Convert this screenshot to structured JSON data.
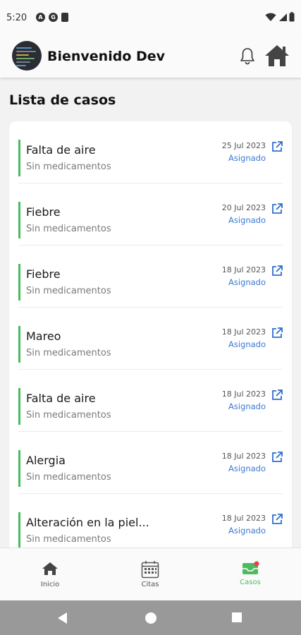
{
  "status_bar": {
    "time": "5:20",
    "left_icons": [
      "A",
      "G",
      "sd-card-icon"
    ]
  },
  "header": {
    "greeting": "Bienvenido Dev"
  },
  "page": {
    "title": "Lista de casos"
  },
  "cases": [
    {
      "title": "Falta de aire",
      "subtitle": "Sin medicamentos",
      "date": "25 Jul 2023",
      "status": "Asignado"
    },
    {
      "title": "Fiebre",
      "subtitle": "Sin medicamentos",
      "date": "20 Jul 2023",
      "status": "Asignado"
    },
    {
      "title": "Fiebre",
      "subtitle": "Sin medicamentos",
      "date": "18 Jul 2023",
      "status": "Asignado"
    },
    {
      "title": "Mareo",
      "subtitle": "Sin medicamentos",
      "date": "18 Jul 2023",
      "status": "Asignado"
    },
    {
      "title": "Falta de aire",
      "subtitle": "Sin medicamentos",
      "date": "18 Jul 2023",
      "status": "Asignado"
    },
    {
      "title": "Alergia",
      "subtitle": "Sin medicamentos",
      "date": "18 Jul 2023",
      "status": "Asignado"
    },
    {
      "title": "Alteración en la piel...",
      "subtitle": "Sin medicamentos",
      "date": "18 Jul 2023",
      "status": "Asignado"
    }
  ],
  "bottom_nav": [
    {
      "label": "Inicio",
      "icon": "home-icon",
      "active": false
    },
    {
      "label": "Citas",
      "icon": "calendar-icon",
      "active": false
    },
    {
      "label": "Casos",
      "icon": "inbox-icon",
      "active": true
    }
  ],
  "colors": {
    "accent": "#4cbb5f",
    "link": "#3b7ad6",
    "system_nav": "#999999"
  }
}
